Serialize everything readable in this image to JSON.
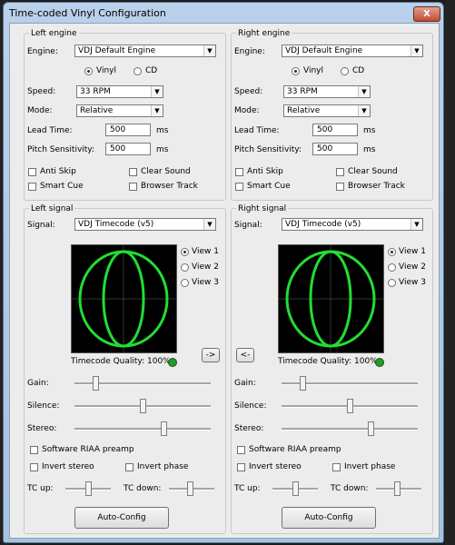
{
  "window": {
    "title": "Time-coded Vinyl Configuration",
    "close_label": "X"
  },
  "left_engine": {
    "group_title": "Left engine",
    "engine_label": "Engine:",
    "engine_value": "VDJ Default Engine",
    "vinyl_label": "Vinyl",
    "cd_label": "CD",
    "selected_media": "Vinyl",
    "speed_label": "Speed:",
    "speed_value": "33 RPM",
    "mode_label": "Mode:",
    "mode_value": "Relative",
    "lead_time_label": "Lead Time:",
    "lead_time_value": "500",
    "lead_time_unit": "ms",
    "pitch_label": "Pitch Sensitivity:",
    "pitch_value": "500",
    "pitch_unit": "ms",
    "anti_skip_label": "Anti Skip",
    "clear_sound_label": "Clear Sound",
    "smart_cue_label": "Smart Cue",
    "browser_track_label": "Browser Track"
  },
  "right_engine": {
    "group_title": "Right engine",
    "engine_label": "Engine:",
    "engine_value": "VDJ Default Engine",
    "vinyl_label": "Vinyl",
    "cd_label": "CD",
    "selected_media": "Vinyl",
    "speed_label": "Speed:",
    "speed_value": "33 RPM",
    "mode_label": "Mode:",
    "mode_value": "Relative",
    "lead_time_label": "Lead Time:",
    "lead_time_value": "500",
    "lead_time_unit": "ms",
    "pitch_label": "Pitch Sensitivity:",
    "pitch_value": "500",
    "pitch_unit": "ms",
    "anti_skip_label": "Anti Skip",
    "clear_sound_label": "Clear Sound",
    "smart_cue_label": "Smart Cue",
    "browser_track_label": "Browser Track"
  },
  "left_signal": {
    "group_title": "Left signal",
    "signal_label": "Signal:",
    "signal_value": "VDJ Timecode (v5)",
    "views": [
      "View 1",
      "View 2",
      "View 3"
    ],
    "selected_view": "View 1",
    "quality_label": "Timecode Quality: 100%",
    "copy_button": "->",
    "gain_label": "Gain:",
    "gain_level": 0.15,
    "silence_label": "Silence:",
    "silence_level": 0.5,
    "stereo_label": "Stereo:",
    "stereo_level": 0.65,
    "riaa_label": "Software RIAA preamp",
    "invert_stereo_label": "Invert stereo",
    "invert_phase_label": "Invert phase",
    "tc_up_label": "TC up:",
    "tc_down_label": "TC down:",
    "autoconfig_label": "Auto-Config"
  },
  "right_signal": {
    "group_title": "Right signal",
    "signal_label": "Signal:",
    "signal_value": "VDJ Timecode (v5)",
    "views": [
      "View 1",
      "View 2",
      "View 3"
    ],
    "selected_view": "View 1",
    "quality_label": "Timecode Quality: 100%",
    "copy_button": "<-",
    "gain_label": "Gain:",
    "gain_level": 0.15,
    "silence_label": "Silence:",
    "silence_level": 0.5,
    "stereo_label": "Stereo:",
    "stereo_level": 0.65,
    "riaa_label": "Software RIAA preamp",
    "invert_stereo_label": "Invert stereo",
    "invert_phase_label": "Invert phase",
    "tc_up_label": "TC up:",
    "tc_down_label": "TC down:",
    "autoconfig_label": "Auto-Config"
  },
  "colors": {
    "scope_trace": "#22dd33",
    "scope_bg": "#000000",
    "quality_ok": "#2a9a2a",
    "window_frame": "#b9d1ea"
  }
}
